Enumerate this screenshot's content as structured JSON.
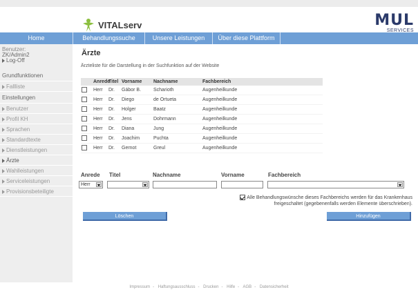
{
  "brand": {
    "logo_text": "VITALserv",
    "partner_word": "MUL",
    "partner_sub": "SERVICES"
  },
  "nav": {
    "items": [
      {
        "label": "Home"
      },
      {
        "label": "Behandlungssuche"
      },
      {
        "label": "Unsere Leistungen"
      },
      {
        "label": "Über diese Plattform"
      }
    ]
  },
  "sidebar": {
    "user_label": "Benutzer:",
    "user_value": "ZK/Admin2",
    "logoff": "Log-Off",
    "sections": [
      {
        "heading": "Grundfunktionen",
        "items": [
          "Fallliste"
        ]
      },
      {
        "heading": "Einstellungen",
        "items": [
          "Benutzer",
          "Profil KH",
          "Sprachen",
          "Standardtexte",
          "Dienstleistungen",
          "Ärzte",
          "Wahlleistungen",
          "Serviceleistungen",
          "Provisionsbeteiligte"
        ]
      }
    ]
  },
  "main": {
    "title": "Ärzte",
    "intro": "Ärzteliste für die Darstellung in der Suchfunktion auf der Website",
    "table": {
      "headers": [
        "Anrede",
        "Titel",
        "Vorname",
        "Nachname",
        "Fachbereich"
      ],
      "rows": [
        [
          "Herr",
          "Dr.",
          "Gábor B.",
          "Scharioth",
          "Augenheilkunde"
        ],
        [
          "Herr",
          "Dr.",
          "Diego",
          "de Ortueta",
          "Augenheilkunde"
        ],
        [
          "Herr",
          "Dr.",
          "Holger",
          "Baatz",
          "Augenheilkunde"
        ],
        [
          "Herr",
          "Dr.",
          "Jens",
          "Dohrmann",
          "Augenheilkunde"
        ],
        [
          "Herr",
          "Dr.",
          "Diana",
          "Jung",
          "Augenheilkunde"
        ],
        [
          "Herr",
          "Dr.",
          "Joachim",
          "Puchta",
          "Augenheilkunde"
        ],
        [
          "Herr",
          "Dr.",
          "Gernot",
          "Greul",
          "Augenheilkunde"
        ]
      ]
    },
    "form": {
      "labels": {
        "anrede": "Anrede",
        "titel": "Titel",
        "nachname": "Nachname",
        "vorname": "Vorname",
        "fachbereich": "Fachbereich"
      },
      "anrede_value": "Herr",
      "titel_value": "",
      "nachname_value": "",
      "vorname_value": "",
      "fachbereich_value": "",
      "checkbox_text": "Alle Behandlungswünsche dieses Fachbereichs werden für das Krankenhaus freigeschaltet (gegebenenfalls werden Elemente überschrieben)."
    },
    "buttons": {
      "delete": "Löschen",
      "add": "Hinzufügen"
    }
  },
  "footer": {
    "links": [
      "Impressum",
      "Haftungsausschluss",
      "Drucken",
      "Hilfe",
      "AGB",
      "Datensicherheit"
    ]
  },
  "colors": {
    "nav": "#6e9fd6",
    "brand_dark": "#2b3a6a",
    "sidebar": "#eeeeee"
  }
}
